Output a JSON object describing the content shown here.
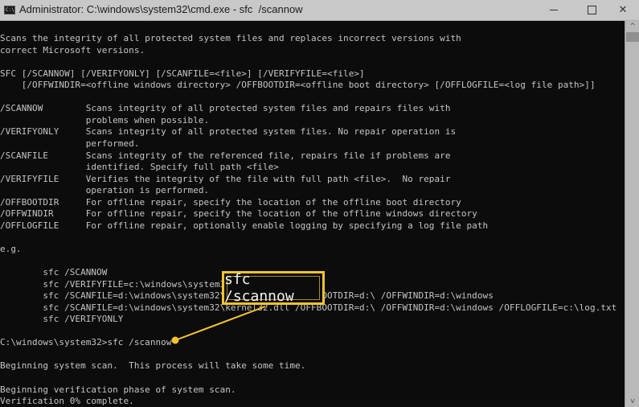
{
  "window": {
    "title": "Administrator: C:\\windows\\system32\\cmd.exe - sfc  /scannow",
    "icon": "cmd-icon",
    "icon_text": "C:\\",
    "controls": {
      "minimize": "minimize-icon",
      "maximize": "maximize-icon",
      "close": "close-icon",
      "close_glyph": "✕"
    }
  },
  "scrollbar": {
    "up_glyph": "^",
    "down_glyph": "v"
  },
  "console": {
    "lines": [
      "Scans the integrity of all protected system files and replaces incorrect versions with",
      "correct Microsoft versions.",
      "",
      "SFC [/SCANNOW] [/VERIFYONLY] [/SCANFILE=<file>] [/VERIFYFILE=<file>]",
      "    [/OFFWINDIR=<offline windows directory> /OFFBOOTDIR=<offline boot directory> [/OFFLOGFILE=<log file path>]]",
      "",
      "/SCANNOW        Scans integrity of all protected system files and repairs files with",
      "                problems when possible.",
      "/VERIFYONLY     Scans integrity of all protected system files. No repair operation is",
      "                performed.",
      "/SCANFILE       Scans integrity of the referenced file, repairs file if problems are",
      "                identified. Specify full path <file>",
      "/VERIFYFILE     Verifies the integrity of the file with full path <file>.  No repair",
      "                operation is performed.",
      "/OFFBOOTDIR     For offline repair, specify the location of the offline boot directory",
      "/OFFWINDIR      For offline repair, specify the location of the offline windows directory",
      "/OFFLOGFILE     For offline repair, optionally enable logging by specifying a log file path",
      "",
      "e.g.",
      "",
      "        sfc /SCANNOW",
      "        sfc /VERIFYFILE=c:\\windows\\system32\\kernel32.dll",
      "        sfc /SCANFILE=d:\\windows\\system32\\kernel32.dll /OFFBOOTDIR=d:\\ /OFFWINDIR=d:\\windows",
      "        sfc /SCANFILE=d:\\windows\\system32\\kernel32.dll /OFFBOOTDIR=d:\\ /OFFWINDIR=d:\\windows /OFFLOGFILE=c:\\log.txt",
      "        sfc /VERIFYONLY",
      "",
      "C:\\windows\\system32>sfc /scannow",
      "",
      "Beginning system scan.  This process will take some time.",
      "",
      "Beginning verification phase of system scan.",
      "Verification 0% complete."
    ]
  },
  "callout": {
    "text": "sfc /scannow",
    "color": "#f4c430"
  }
}
